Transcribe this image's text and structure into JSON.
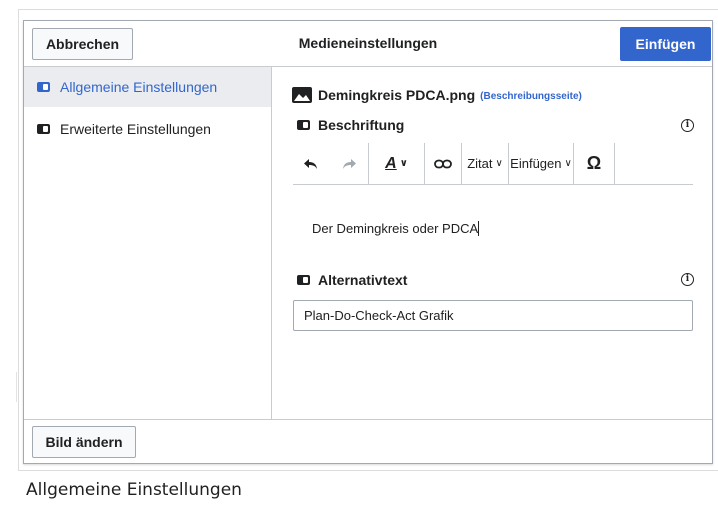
{
  "dialog": {
    "title": "Medieneinstellungen",
    "cancel_label": "Abbrechen",
    "insert_label": "Einfügen",
    "change_image_label": "Bild ändern"
  },
  "sidebar": {
    "items": [
      {
        "label": "Allgemeine Einstellungen",
        "active": true
      },
      {
        "label": "Erweiterte Einstellungen",
        "active": false
      }
    ]
  },
  "file": {
    "name": "Demingkreis PDCA.png",
    "description_link": "(Beschreibungsseite)"
  },
  "caption": {
    "label": "Beschriftung",
    "value": "Der Demingkreis oder PDCA",
    "toolbar": {
      "quote_label": "Zitat",
      "insert_label": "Einfügen",
      "style_label": "A",
      "special_char_label": "Ω"
    }
  },
  "alt_text": {
    "label": "Alternativtext",
    "value": "Plan-Do-Check-Act Grafik"
  },
  "figure_caption": "Allgemeine Einstellungen",
  "colors": {
    "accent": "#3366cc",
    "active_bg": "#eaecf0",
    "border": "#c8ccd1"
  }
}
